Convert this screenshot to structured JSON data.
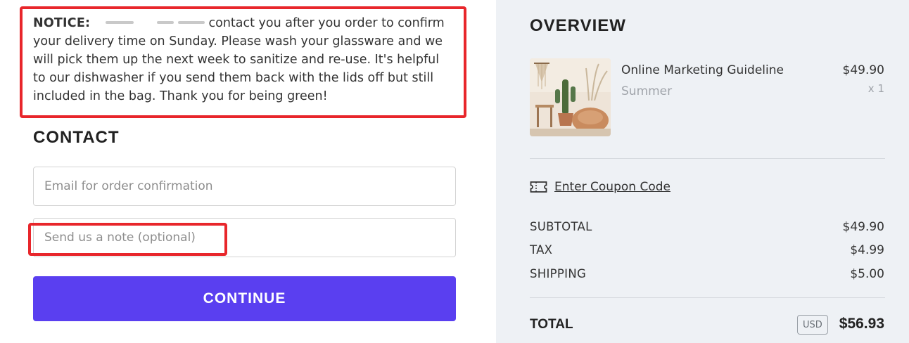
{
  "notice": {
    "label": "NOTICE:",
    "text_after_redaction": "contact you after you order to confirm your delivery time on Sunday. Please wash your glassware and we will pick them up the next week to sanitize and re-use. It's helpful to our dishwasher if you send them back with the lids off but still included in the bag. Thank you for being green!"
  },
  "contact": {
    "heading": "CONTACT",
    "email_placeholder": "Email for order confirmation",
    "note_placeholder": "Send us a note (optional)",
    "continue_label": "CONTINUE"
  },
  "overview": {
    "heading": "OVERVIEW",
    "item": {
      "name": "Online Marketing Guideline",
      "variant": "Summer",
      "price": "$49.90",
      "quantity": "x 1"
    },
    "coupon_label": "Enter Coupon Code",
    "subtotal_label": "SUBTOTAL",
    "subtotal_value": "$49.90",
    "tax_label": "TAX",
    "tax_value": "$4.99",
    "shipping_label": "SHIPPING",
    "shipping_value": "$5.00",
    "total_label": "TOTAL",
    "currency": "USD",
    "total_value": "$56.93"
  },
  "colors": {
    "highlight": "#e8262b",
    "continue_button": "#5a3ff0",
    "summary_background": "#eef1f5"
  }
}
